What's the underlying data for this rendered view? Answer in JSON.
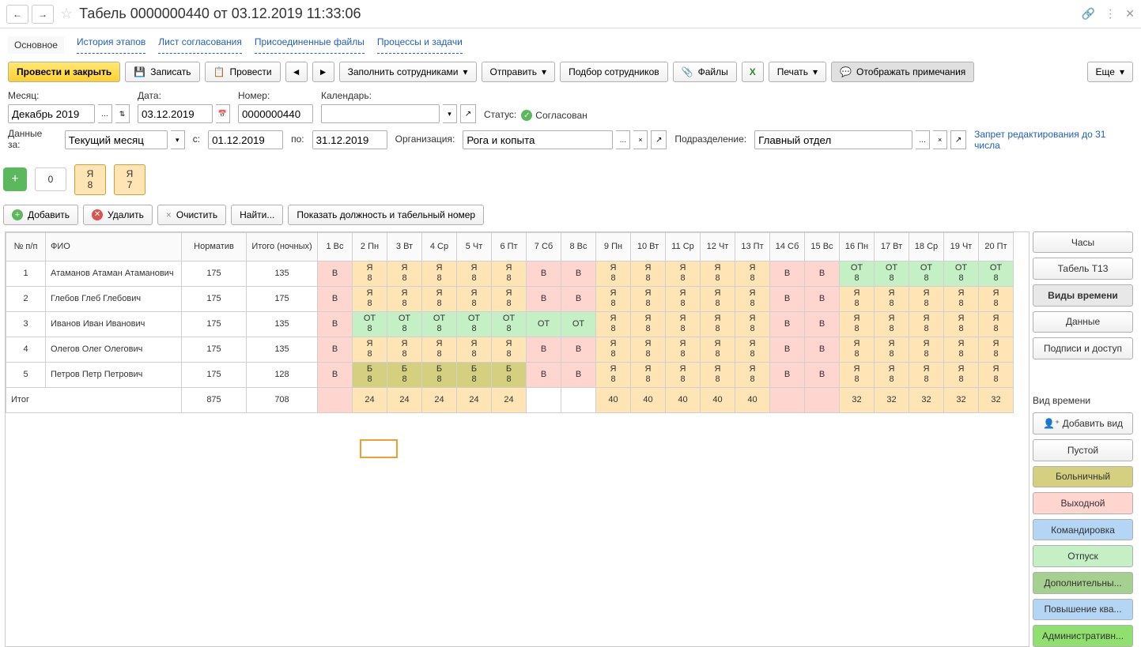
{
  "title": "Табель 0000000440 от 03.12.2019 11:33:06",
  "tabs": [
    "Основное",
    "История этапов",
    "Лист согласования",
    "Присоединенные файлы",
    "Процессы и задачи"
  ],
  "toolbar": {
    "post_close": "Провести и закрыть",
    "save": "Записать",
    "post": "Провести",
    "fill_emp": "Заполнить сотрудниками",
    "send": "Отправить",
    "pick_emp": "Подбор сотрудников",
    "files": "Файлы",
    "print": "Печать",
    "show_notes": "Отображать примечания",
    "more": "Еще"
  },
  "fields": {
    "month_label": "Месяц:",
    "month": "Декабрь 2019",
    "date_label": "Дата:",
    "date": "03.12.2019",
    "number_label": "Номер:",
    "number": "0000000440",
    "calendar_label": "Календарь:",
    "calendar": "",
    "status_label": "Статус:",
    "status_value": "Согласован",
    "data_for_label": "Данные за:",
    "data_for": "Текущий месяц",
    "from_label": "с:",
    "from": "01.12.2019",
    "to_label": "по:",
    "to": "31.12.2019",
    "org_label": "Организация:",
    "org": "Рога и копыта",
    "dept_label": "Подразделение:",
    "dept": "Главный отдел",
    "lock_note": "Запрет редактирования до 31 числа"
  },
  "badges": {
    "zero": "0",
    "y8t": "Я",
    "y8b": "8",
    "y7t": "Я",
    "y7b": "7"
  },
  "tbl_toolbar": {
    "add": "Добавить",
    "del": "Удалить",
    "clear": "Очистить",
    "find": "Найти...",
    "show_pos": "Показать должность и табельный номер"
  },
  "columns": {
    "num": "№ п/п",
    "fio": "ФИО",
    "norm": "Норматив",
    "total": "Итого (ночных)",
    "days": [
      "1 Вс",
      "2 Пн",
      "3 Вт",
      "4 Ср",
      "5 Чт",
      "6 Пт",
      "7 Сб",
      "8 Вс",
      "9 Пн",
      "10 Вт",
      "11 Ср",
      "12 Чт",
      "13 Пт",
      "14 Сб",
      "15 Вс",
      "16 Пн",
      "17 Вт",
      "18 Ср",
      "19 Чт",
      "20 Пт"
    ]
  },
  "rows": [
    {
      "num": "1",
      "fio": "Атаманов Атаман Атаманович",
      "norm": "175",
      "total": "135",
      "days": [
        {
          "c": "v",
          "t": "В",
          "b": ""
        },
        {
          "c": "ya",
          "t": "Я",
          "b": "8"
        },
        {
          "c": "ya",
          "t": "Я",
          "b": "8"
        },
        {
          "c": "ya",
          "t": "Я",
          "b": "8"
        },
        {
          "c": "ya",
          "t": "Я",
          "b": "8"
        },
        {
          "c": "ya",
          "t": "Я",
          "b": "8"
        },
        {
          "c": "v",
          "t": "В",
          "b": ""
        },
        {
          "c": "v",
          "t": "В",
          "b": ""
        },
        {
          "c": "ya",
          "t": "Я",
          "b": "8"
        },
        {
          "c": "ya",
          "t": "Я",
          "b": "8"
        },
        {
          "c": "ya",
          "t": "Я",
          "b": "8"
        },
        {
          "c": "ya",
          "t": "Я",
          "b": "8"
        },
        {
          "c": "ya",
          "t": "Я",
          "b": "8"
        },
        {
          "c": "v",
          "t": "В",
          "b": ""
        },
        {
          "c": "v",
          "t": "В",
          "b": ""
        },
        {
          "c": "ot",
          "t": "ОТ",
          "b": "8"
        },
        {
          "c": "ot",
          "t": "ОТ",
          "b": "8"
        },
        {
          "c": "ot",
          "t": "ОТ",
          "b": "8"
        },
        {
          "c": "ot",
          "t": "ОТ",
          "b": "8"
        },
        {
          "c": "ot",
          "t": "ОТ",
          "b": "8"
        }
      ]
    },
    {
      "num": "2",
      "fio": "Глебов Глеб Глебович",
      "norm": "175",
      "total": "175",
      "days": [
        {
          "c": "v",
          "t": "В",
          "b": ""
        },
        {
          "c": "ya",
          "t": "Я",
          "b": "8"
        },
        {
          "c": "ya",
          "t": "Я",
          "b": "8"
        },
        {
          "c": "ya",
          "t": "Я",
          "b": "8"
        },
        {
          "c": "ya",
          "t": "Я",
          "b": "8"
        },
        {
          "c": "ya",
          "t": "Я",
          "b": "8"
        },
        {
          "c": "v",
          "t": "В",
          "b": ""
        },
        {
          "c": "v",
          "t": "В",
          "b": ""
        },
        {
          "c": "ya",
          "t": "Я",
          "b": "8"
        },
        {
          "c": "ya",
          "t": "Я",
          "b": "8"
        },
        {
          "c": "ya",
          "t": "Я",
          "b": "8"
        },
        {
          "c": "ya",
          "t": "Я",
          "b": "8"
        },
        {
          "c": "ya",
          "t": "Я",
          "b": "8"
        },
        {
          "c": "v",
          "t": "В",
          "b": ""
        },
        {
          "c": "v",
          "t": "В",
          "b": ""
        },
        {
          "c": "ya",
          "t": "Я",
          "b": "8"
        },
        {
          "c": "ya",
          "t": "Я",
          "b": "8"
        },
        {
          "c": "ya",
          "t": "Я",
          "b": "8"
        },
        {
          "c": "ya",
          "t": "Я",
          "b": "8"
        },
        {
          "c": "ya",
          "t": "Я",
          "b": "8"
        }
      ]
    },
    {
      "num": "3",
      "fio": "Иванов Иван Иванович",
      "norm": "175",
      "total": "135",
      "days": [
        {
          "c": "v",
          "t": "В",
          "b": ""
        },
        {
          "c": "ot",
          "t": "ОТ",
          "b": "8"
        },
        {
          "c": "ot",
          "t": "ОТ",
          "b": "8"
        },
        {
          "c": "ot",
          "t": "ОТ",
          "b": "8"
        },
        {
          "c": "ot",
          "t": "ОТ",
          "b": "8"
        },
        {
          "c": "ot",
          "t": "ОТ",
          "b": "8"
        },
        {
          "c": "ot",
          "t": "ОТ",
          "b": ""
        },
        {
          "c": "ot",
          "t": "ОТ",
          "b": ""
        },
        {
          "c": "ya",
          "t": "Я",
          "b": "8"
        },
        {
          "c": "ya",
          "t": "Я",
          "b": "8"
        },
        {
          "c": "ya",
          "t": "Я",
          "b": "8"
        },
        {
          "c": "ya",
          "t": "Я",
          "b": "8"
        },
        {
          "c": "ya",
          "t": "Я",
          "b": "8"
        },
        {
          "c": "v",
          "t": "В",
          "b": ""
        },
        {
          "c": "v",
          "t": "В",
          "b": ""
        },
        {
          "c": "ya",
          "t": "Я",
          "b": "8"
        },
        {
          "c": "ya",
          "t": "Я",
          "b": "8"
        },
        {
          "c": "ya",
          "t": "Я",
          "b": "8"
        },
        {
          "c": "ya",
          "t": "Я",
          "b": "8"
        },
        {
          "c": "ya",
          "t": "Я",
          "b": "8"
        }
      ]
    },
    {
      "num": "4",
      "fio": "Олегов Олег Олегович",
      "norm": "175",
      "total": "135",
      "days": [
        {
          "c": "v",
          "t": "В",
          "b": ""
        },
        {
          "c": "ya",
          "t": "Я",
          "b": "8"
        },
        {
          "c": "ya",
          "t": "Я",
          "b": "8"
        },
        {
          "c": "ya",
          "t": "Я",
          "b": "8"
        },
        {
          "c": "ya",
          "t": "Я",
          "b": "8"
        },
        {
          "c": "ya",
          "t": "Я",
          "b": "8"
        },
        {
          "c": "v",
          "t": "В",
          "b": ""
        },
        {
          "c": "v",
          "t": "В",
          "b": ""
        },
        {
          "c": "ya",
          "t": "Я",
          "b": "8"
        },
        {
          "c": "ya",
          "t": "Я",
          "b": "8"
        },
        {
          "c": "ya",
          "t": "Я",
          "b": "8"
        },
        {
          "c": "ya",
          "t": "Я",
          "b": "8"
        },
        {
          "c": "ya",
          "t": "Я",
          "b": "8"
        },
        {
          "c": "v",
          "t": "В",
          "b": ""
        },
        {
          "c": "v",
          "t": "В",
          "b": ""
        },
        {
          "c": "ya",
          "t": "Я",
          "b": "8"
        },
        {
          "c": "ya",
          "t": "Я",
          "b": "8"
        },
        {
          "c": "ya",
          "t": "Я",
          "b": "8"
        },
        {
          "c": "ya",
          "t": "Я",
          "b": "8"
        },
        {
          "c": "ya",
          "t": "Я",
          "b": "8"
        }
      ]
    },
    {
      "num": "5",
      "fio": "Петров Петр Петрович",
      "norm": "175",
      "total": "128",
      "days": [
        {
          "c": "v",
          "t": "В",
          "b": ""
        },
        {
          "c": "b",
          "t": "Б",
          "b": "8"
        },
        {
          "c": "b",
          "t": "Б",
          "b": "8"
        },
        {
          "c": "b",
          "t": "Б",
          "b": "8"
        },
        {
          "c": "b",
          "t": "Б",
          "b": "8"
        },
        {
          "c": "b",
          "t": "Б",
          "b": "8"
        },
        {
          "c": "v",
          "t": "В",
          "b": ""
        },
        {
          "c": "v",
          "t": "В",
          "b": ""
        },
        {
          "c": "ya",
          "t": "Я",
          "b": "8"
        },
        {
          "c": "ya",
          "t": "Я",
          "b": "8"
        },
        {
          "c": "ya",
          "t": "Я",
          "b": "8"
        },
        {
          "c": "ya",
          "t": "Я",
          "b": "8"
        },
        {
          "c": "ya",
          "t": "Я",
          "b": "8"
        },
        {
          "c": "v",
          "t": "В",
          "b": ""
        },
        {
          "c": "v",
          "t": "В",
          "b": ""
        },
        {
          "c": "ya",
          "t": "Я",
          "b": "8"
        },
        {
          "c": "ya",
          "t": "Я",
          "b": "8"
        },
        {
          "c": "ya",
          "t": "Я",
          "b": "8"
        },
        {
          "c": "ya",
          "t": "Я",
          "b": "8"
        },
        {
          "c": "ya",
          "t": "Я",
          "b": "8"
        }
      ]
    }
  ],
  "footer": {
    "label": "Итог",
    "norm": "875",
    "total": "708",
    "days": [
      {
        "c": "v",
        "v": ""
      },
      {
        "c": "ya",
        "v": "24"
      },
      {
        "c": "ya",
        "v": "24"
      },
      {
        "c": "ya",
        "v": "24"
      },
      {
        "c": "ya",
        "v": "24"
      },
      {
        "c": "ya",
        "v": "24"
      },
      {
        "c": "",
        "v": ""
      },
      {
        "c": "",
        "v": ""
      },
      {
        "c": "ya",
        "v": "40"
      },
      {
        "c": "ya",
        "v": "40"
      },
      {
        "c": "ya",
        "v": "40"
      },
      {
        "c": "ya",
        "v": "40"
      },
      {
        "c": "ya",
        "v": "40"
      },
      {
        "c": "v",
        "v": ""
      },
      {
        "c": "v",
        "v": ""
      },
      {
        "c": "ya",
        "v": "32"
      },
      {
        "c": "ya",
        "v": "32"
      },
      {
        "c": "ya",
        "v": "32"
      },
      {
        "c": "ya",
        "v": "32"
      },
      {
        "c": "ya",
        "v": "32"
      }
    ]
  },
  "sidebar": {
    "hours": "Часы",
    "t13": "Табель Т13",
    "time_types": "Виды времени",
    "data": "Данные",
    "sigs": "Подписи и доступ",
    "type_label": "Вид времени",
    "add_type": "Добавить вид",
    "empty": "Пустой",
    "sick": "Больничный",
    "weekend": "Выходной",
    "trip": "Командировка",
    "vac": "Отпуск",
    "extra": "Дополнительны...",
    "qual": "Повышение ква...",
    "admin": "Административн..."
  }
}
